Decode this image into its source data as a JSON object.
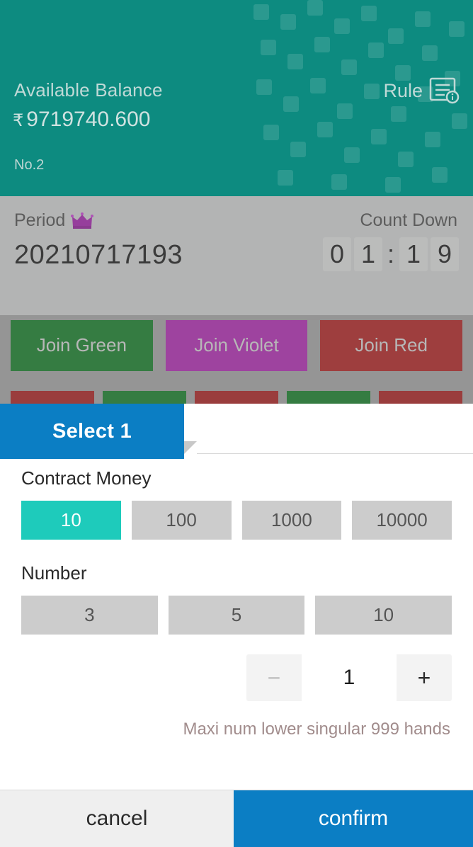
{
  "header": {
    "balance_label": "Available Balance",
    "currency_symbol": "₹",
    "balance_amount": "9719740.600",
    "account_no": "No.2",
    "rule_label": "Rule",
    "rule_icon": "document-info-icon",
    "bg_color": "#0d8b80"
  },
  "period": {
    "period_label": "Period",
    "crown_icon": "crown-icon",
    "period_value": "20210717193",
    "countdown_label": "Count Down",
    "countdown": {
      "d1": "0",
      "d2": "1",
      "separator": ":",
      "d3": "1",
      "d4": "9"
    }
  },
  "join_buttons": [
    {
      "label": "Join Green",
      "color": "#157a27"
    },
    {
      "label": "Join Violet",
      "color": "#ab29ac"
    },
    {
      "label": "Join Red",
      "color": "#ab2222"
    }
  ],
  "number_chips": [
    {
      "color": "#a52020"
    },
    {
      "color": "#157a27"
    },
    {
      "color": "#a52020"
    },
    {
      "color": "#157a27"
    },
    {
      "color": "#a52020"
    }
  ],
  "sheet": {
    "tab_label": "Select 1",
    "tab_color": "#0b7ec4",
    "contract_money": {
      "title": "Contract Money",
      "options": [
        {
          "label": "10",
          "selected": true
        },
        {
          "label": "100",
          "selected": false
        },
        {
          "label": "1000",
          "selected": false
        },
        {
          "label": "10000",
          "selected": false
        }
      ],
      "selected_color": "#1ecbbb"
    },
    "number": {
      "title": "Number",
      "options": [
        {
          "label": "3",
          "selected": false
        },
        {
          "label": "5",
          "selected": false
        },
        {
          "label": "10",
          "selected": false
        }
      ]
    },
    "stepper": {
      "decrement_label": "−",
      "value": "1",
      "increment_label": "+"
    },
    "hint": "Maxi num lower singular 999 hands",
    "footer": {
      "cancel_label": "cancel",
      "confirm_label": "confirm"
    }
  }
}
